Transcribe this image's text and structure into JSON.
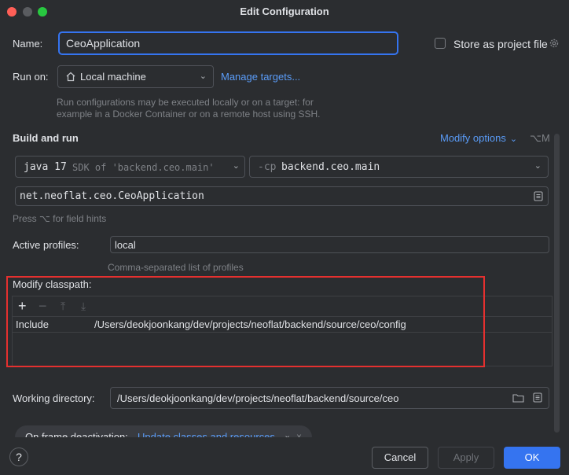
{
  "window": {
    "title": "Edit Configuration"
  },
  "name_row": {
    "label": "Name:",
    "value": "CeoApplication",
    "store_label": "Store as project file"
  },
  "run_on": {
    "label": "Run on:",
    "value": "Local machine",
    "manage_link": "Manage targets...",
    "hint_line1": "Run configurations may be executed locally or on a target: for",
    "hint_line2": "example in a Docker Container or on a remote host using SSH."
  },
  "build": {
    "heading": "Build and run",
    "modify_options": "Modify options",
    "shortcut": "⌥M",
    "jdk_version": "java 17",
    "jdk_detail": "SDK of 'backend.ceo.main'",
    "cp_flag": "-cp",
    "cp_value": "backend.ceo.main",
    "main_class": "net.neoflat.ceo.CeoApplication",
    "field_hint": "Press ⌥ for field hints"
  },
  "profiles": {
    "label": "Active profiles:",
    "value": "local",
    "hint": "Comma-separated list of profiles"
  },
  "classpath": {
    "heading": "Modify classpath:",
    "rows": [
      {
        "type": "Include",
        "path": "/Users/deokjoonkang/dev/projects/neoflat/backend/source/ceo/config"
      }
    ]
  },
  "working_dir": {
    "label": "Working directory:",
    "value": "/Users/deokjoonkang/dev/projects/neoflat/backend/source/ceo"
  },
  "frame_deactivation": {
    "label": "On frame deactivation:",
    "value": "Update classes and resources"
  },
  "footer": {
    "help": "?",
    "cancel": "Cancel",
    "apply": "Apply",
    "ok": "OK"
  },
  "colors": {
    "accent": "#3574f0",
    "highlight_border": "#e5302f",
    "background": "#2b2d30",
    "link": "#5a9cf8"
  }
}
